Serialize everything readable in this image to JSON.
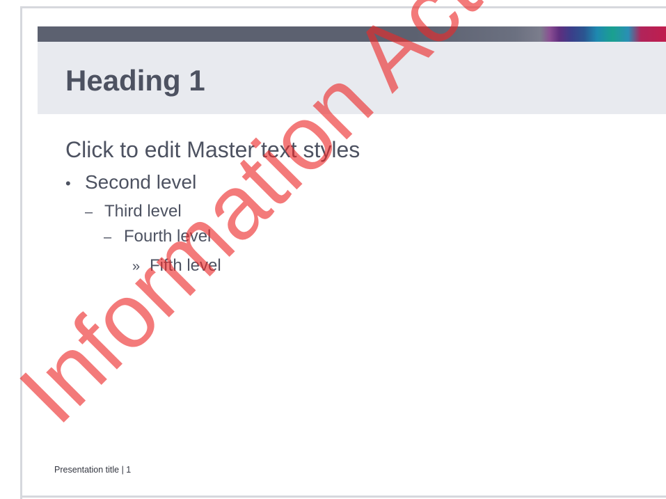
{
  "slide": {
    "heading": "Heading 1",
    "body": {
      "level1": "Click to edit Master text styles",
      "level2": {
        "bullet": "•",
        "text": "Second level"
      },
      "level3": {
        "bullet": "–",
        "text": "Third level"
      },
      "level4": {
        "bullet": "–",
        "text": "Fourth level"
      },
      "level5": {
        "bullet": "»",
        "text": "Fifth level"
      }
    },
    "footer": "Presentation title | 1"
  },
  "watermark": "Information Act",
  "colors": {
    "title_text": "#4d5261",
    "heading_band": "#e8eaef",
    "top_bar": "#5c6170",
    "watermark": "#ec2828"
  }
}
